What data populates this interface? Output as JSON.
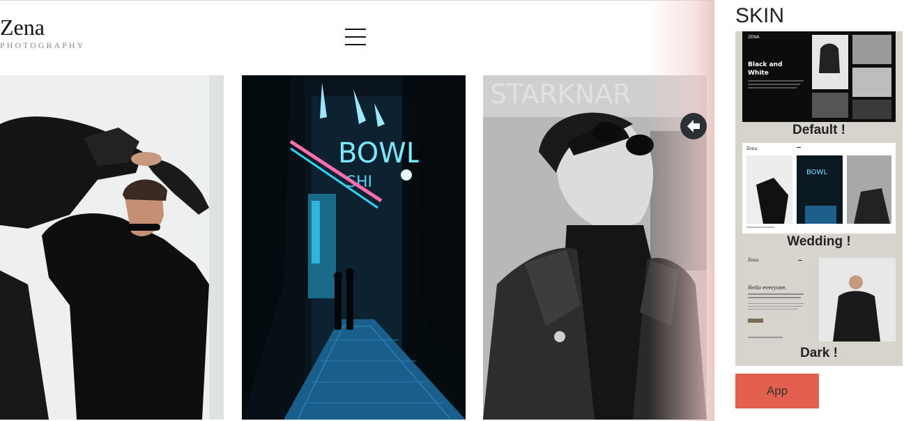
{
  "site": {
    "logo_title": "Zena",
    "logo_subtitle": "PHOTOGRAPHY",
    "menu_icon": "hamburger-icon",
    "next_icon": "arrow-left-icon"
  },
  "skin_panel": {
    "title": "SKIN",
    "skins": [
      {
        "label": "Default !",
        "preview_heading": "Black and White",
        "preview_logo": "ZENA"
      },
      {
        "label": "Wedding !",
        "preview_logo": "Zena"
      },
      {
        "label": "Dark !",
        "preview_logo": "Zena",
        "preview_heading": "Hello everyone,"
      }
    ],
    "app_button": "App",
    "colors": {
      "panel_bg": "#d7d4cd",
      "app_button": "#e35f4e"
    }
  }
}
